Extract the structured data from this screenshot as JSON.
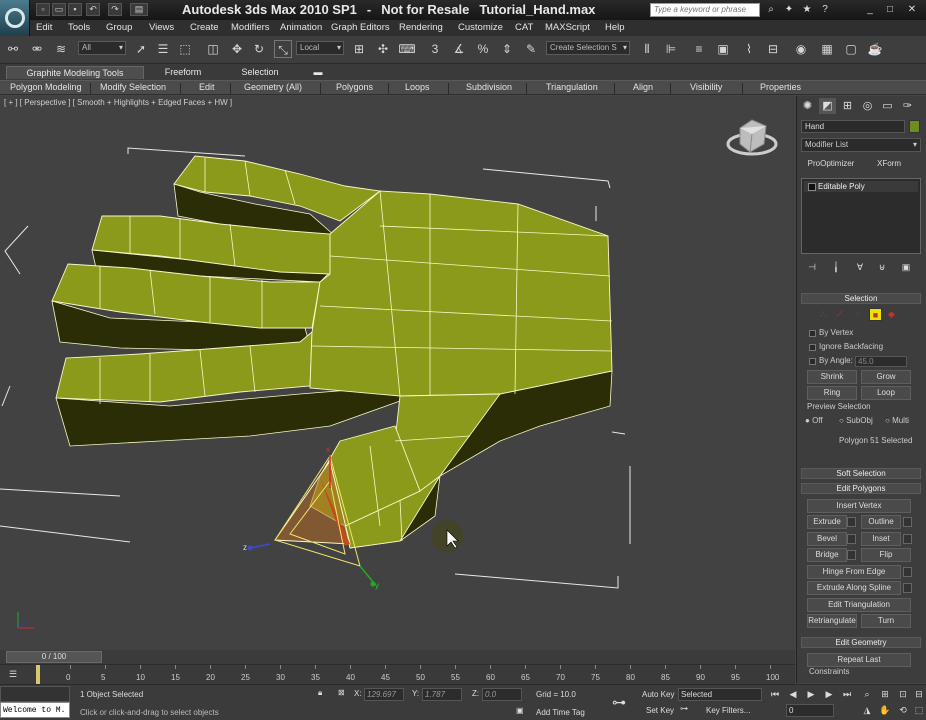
{
  "window": {
    "title_parts": [
      "Autodesk 3ds Max  2010 SP1",
      "-",
      "Not for Resale",
      "Tutorial_Hand.max"
    ],
    "search_placeholder": "Type a keyword or phrase"
  },
  "menu": [
    "Edit",
    "Tools",
    "Group",
    "Views",
    "Create",
    "Modifiers",
    "Animation",
    "Graph Editors",
    "Rendering",
    "Customize",
    "CAT",
    "MAXScript",
    "Help"
  ],
  "toolbar": {
    "selection_filter": "All",
    "ref_coord": "Local",
    "named_selection": "Create Selection S"
  },
  "ribbon": {
    "tabs": [
      "Graphite Modeling Tools",
      "Freeform",
      "Selection"
    ],
    "active_tab": "Graphite Modeling Tools",
    "panels": [
      "Polygon Modeling",
      "Modify Selection",
      "Edit",
      "Geometry (All)",
      "Polygons",
      "Loops",
      "Subdivision",
      "Triangulation",
      "Align",
      "Visibility",
      "Properties"
    ]
  },
  "viewport": {
    "label": "[ + ] [ Perspective ] [ Smooth + Highlights + Edged Faces + HW ]",
    "gizmo_axes": [
      "z",
      "x",
      "y"
    ],
    "mesh_color": "#8b9a1a",
    "edge_color": "#fbf7c6"
  },
  "command_panel": {
    "object_name": "Hand",
    "object_color": "#6b8e1e",
    "modifier_list": "Modifier List",
    "quick_buttons": [
      "ProOptimizer",
      "XForm"
    ],
    "stack_item": "Editable Poly",
    "selection": {
      "title": "Selection",
      "by_vertex": "By Vertex",
      "ignore_backfacing": "Ignore Backfacing",
      "by_angle": "By Angle:",
      "angle_value": "45.0",
      "shrink": "Shrink",
      "grow": "Grow",
      "ring": "Ring",
      "loop": "Loop",
      "preview_title": "Preview Selection",
      "preview_options": [
        "Off",
        "SubObj",
        "Multi"
      ],
      "status": "Polygon 51 Selected"
    },
    "soft_selection": "Soft Selection",
    "edit_polygons": {
      "title": "Edit Polygons",
      "insert_vertex": "Insert Vertex",
      "extrude": "Extrude",
      "outline": "Outline",
      "bevel": "Bevel",
      "inset": "Inset",
      "bridge": "Bridge",
      "flip": "Flip",
      "hinge": "Hinge From Edge",
      "extrude_spline": "Extrude Along Spline",
      "edit_triangulation": "Edit Triangulation",
      "retriangulate": "Retriangulate",
      "turn": "Turn"
    },
    "edit_geometry": {
      "title": "Edit Geometry",
      "repeat_last": "Repeat Last",
      "constraints": "Constraints"
    }
  },
  "timeline": {
    "slider": "0 / 100",
    "ticks": [
      "0",
      "5",
      "10",
      "15",
      "20",
      "25",
      "30",
      "35",
      "40",
      "45",
      "50",
      "55",
      "60",
      "65",
      "70",
      "75",
      "80",
      "85",
      "90",
      "95",
      "100"
    ]
  },
  "status": {
    "maxscript": "Welcome to M.",
    "selected": "1 Object Selected",
    "prompt": "Click or click-and-drag to select objects",
    "x_label": "X:",
    "x": "129.697",
    "y_label": "Y:",
    "y": "1.787",
    "z_label": "Z:",
    "z": "0.0",
    "grid": "Grid = 10.0",
    "add_time_tag": "Add Time Tag",
    "auto_key": "Auto Key",
    "set_key": "Set Key",
    "key_mode": "Selected",
    "key_filters": "Key Filters...",
    "frame": "0"
  }
}
